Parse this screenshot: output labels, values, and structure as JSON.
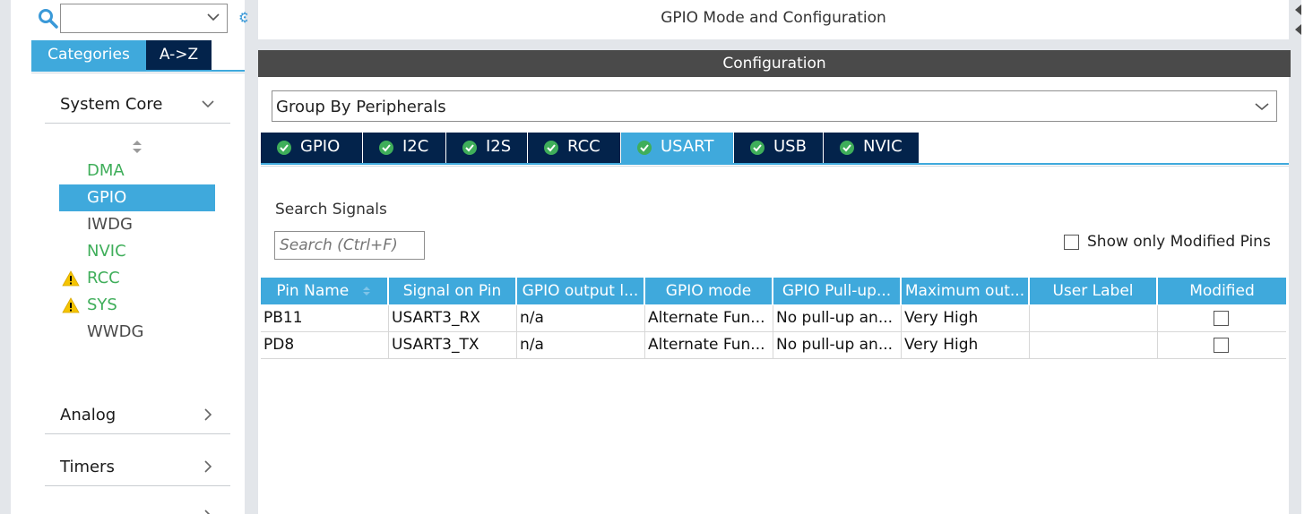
{
  "left_panel": {
    "search": {
      "placeholder": ""
    },
    "tabs": [
      {
        "label": "Categories",
        "selected": true
      },
      {
        "label": "A->Z",
        "selected": false
      }
    ],
    "categories": [
      {
        "label": "System Core",
        "expanded": true
      },
      {
        "label": "Analog",
        "expanded": false
      },
      {
        "label": "Timers",
        "expanded": false
      }
    ],
    "system_core_items": [
      {
        "label": "DMA",
        "status": "configured",
        "warning": false
      },
      {
        "label": "GPIO",
        "status": "selected",
        "warning": false
      },
      {
        "label": "IWDG",
        "status": "default",
        "warning": false
      },
      {
        "label": "NVIC",
        "status": "configured",
        "warning": false
      },
      {
        "label": "RCC",
        "status": "configured",
        "warning": true
      },
      {
        "label": "SYS",
        "status": "configured",
        "warning": true
      },
      {
        "label": "WWDG",
        "status": "default",
        "warning": false
      }
    ],
    "colors": {
      "accent": "#3fa9dc",
      "navy": "#03234b",
      "configured": "#3fae5a",
      "warning": "#f5c400"
    }
  },
  "main": {
    "title": "GPIO Mode and Configuration",
    "config_header": "Configuration",
    "group_by": "Group By Peripherals",
    "tabs": [
      {
        "label": "GPIO",
        "selected": false
      },
      {
        "label": "I2C",
        "selected": false
      },
      {
        "label": "I2S",
        "selected": false
      },
      {
        "label": "RCC",
        "selected": false
      },
      {
        "label": "USART",
        "selected": true
      },
      {
        "label": "USB",
        "selected": false
      },
      {
        "label": "NVIC",
        "selected": false
      }
    ],
    "search_signals": {
      "label": "Search Signals",
      "placeholder": "Search (Ctrl+F)"
    },
    "show_modified": {
      "label": "Show only Modified Pins",
      "checked": false
    },
    "table": {
      "columns": [
        "Pin Name",
        "Signal on Pin",
        "GPIO output l...",
        "GPIO mode",
        "GPIO Pull-up...",
        "Maximum out...",
        "User Label",
        "Modified"
      ],
      "rows": [
        {
          "pin": "PB11",
          "signal": "USART3_RX",
          "output_level": "n/a",
          "mode": "Alternate Fun...",
          "pull": "No pull-up an...",
          "max_speed": "Very High",
          "user_label": "",
          "modified": false
        },
        {
          "pin": "PD8",
          "signal": "USART3_TX",
          "output_level": "n/a",
          "mode": "Alternate Fun...",
          "pull": "No pull-up an...",
          "max_speed": "Very High",
          "user_label": "",
          "modified": false
        }
      ]
    }
  }
}
